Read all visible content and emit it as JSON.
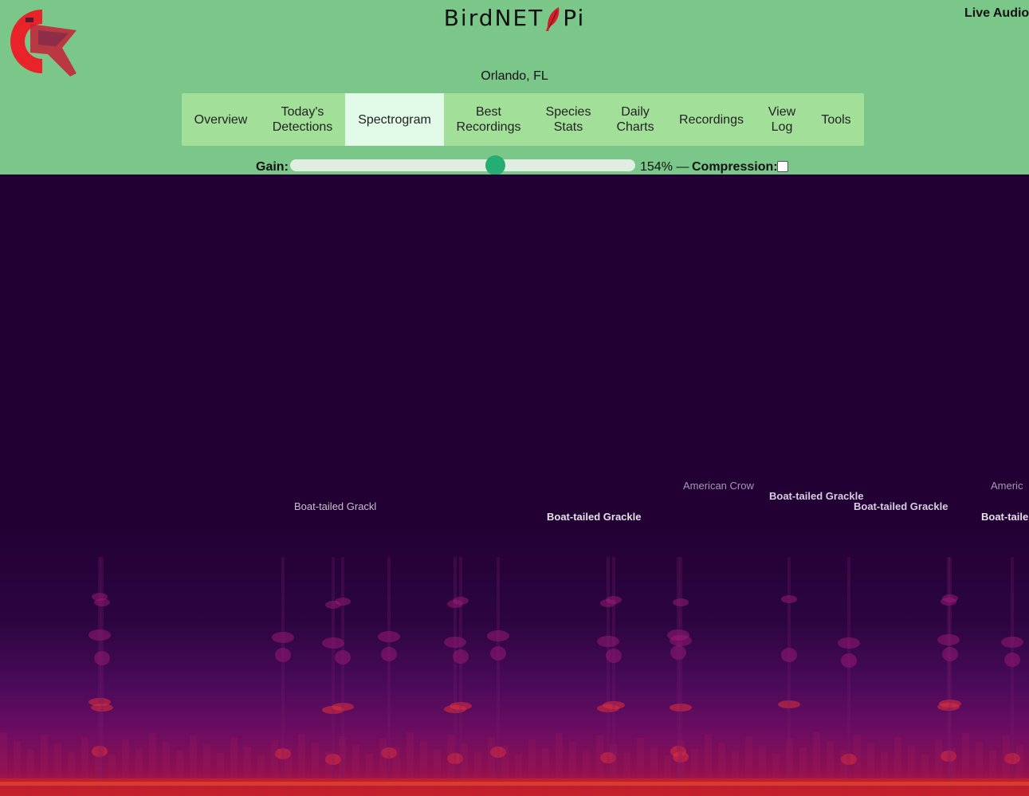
{
  "header": {
    "title_left": "BirdNET",
    "title_right": "Pi",
    "live_audio": "Live Audio",
    "location": "Orlando, FL"
  },
  "nav": {
    "items": [
      {
        "lines": [
          "Overview"
        ],
        "active": false
      },
      {
        "lines": [
          "Today's",
          "Detections"
        ],
        "active": false
      },
      {
        "lines": [
          "Spectrogram"
        ],
        "active": true
      },
      {
        "lines": [
          "Best",
          "Recordings"
        ],
        "active": false
      },
      {
        "lines": [
          "Species",
          "Stats"
        ],
        "active": false
      },
      {
        "lines": [
          "Daily",
          "Charts"
        ],
        "active": false
      },
      {
        "lines": [
          "Recordings"
        ],
        "active": false
      },
      {
        "lines": [
          "View",
          "Log"
        ],
        "active": false
      },
      {
        "lines": [
          "Tools"
        ],
        "active": false
      }
    ]
  },
  "controls": {
    "gain_label": "Gain:",
    "gain_value": "154% —",
    "gain_fraction": 0.6,
    "compression_label": "Compression:",
    "compression_checked": false
  },
  "spectrogram": {
    "detections": [
      {
        "text": "Boat-tailed Grackl"
      },
      {
        "text": "Boat-tailed Grackle"
      },
      {
        "text": "American Crow"
      },
      {
        "text": "Boat-tailed Grackle"
      },
      {
        "text": "Boat-tailed Grackle"
      },
      {
        "text": "Americ"
      },
      {
        "text": "Boat-taile"
      }
    ]
  },
  "colors": {
    "header_bg": "#7bc78a",
    "nav_bg": "#a2e09a",
    "nav_active_bg": "#e2fbe9",
    "slider_thumb": "#25ad73",
    "spectrogram_bg": "#220033",
    "logo_red": "#e8232a"
  }
}
